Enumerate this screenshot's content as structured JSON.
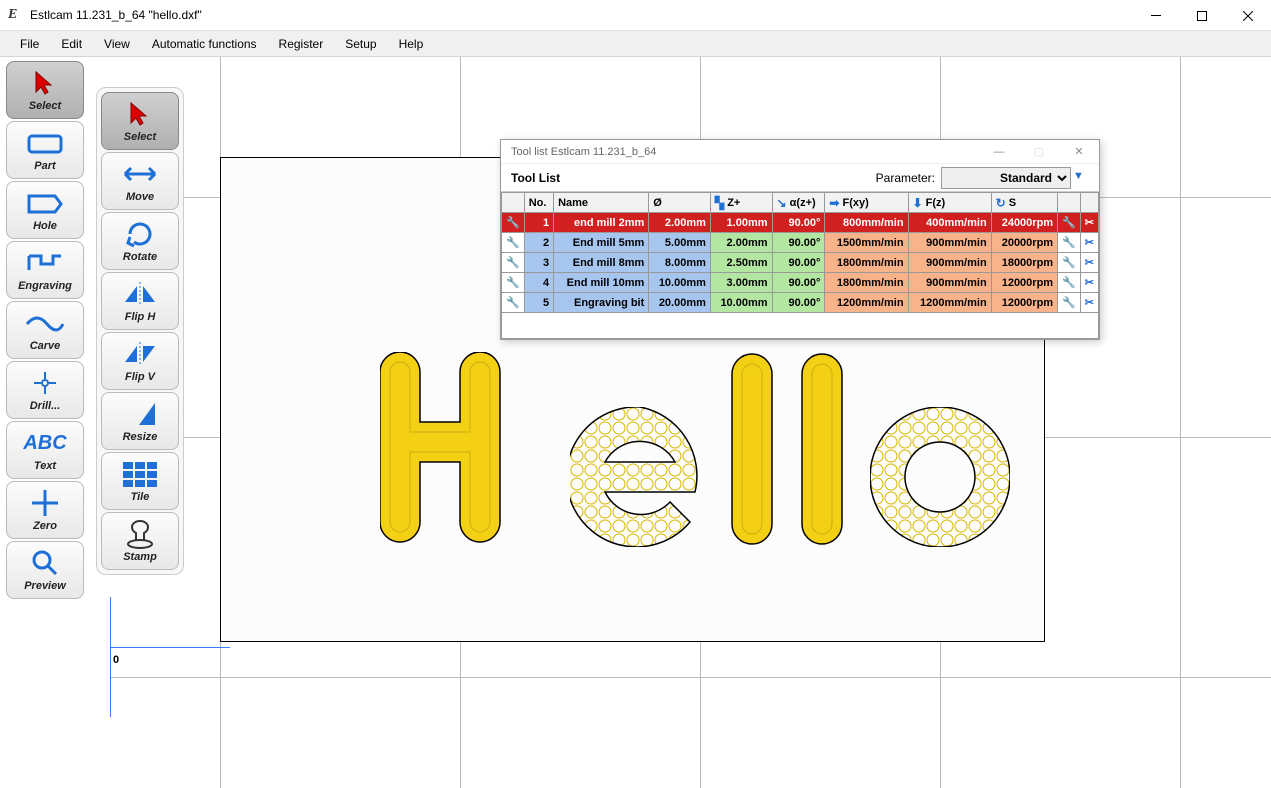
{
  "window": {
    "title": "Estlcam 11.231_b_64 \"hello.dxf\"",
    "app_abbrev": "E"
  },
  "menu": {
    "items": [
      "File",
      "Edit",
      "View",
      "Automatic functions",
      "Register",
      "Setup",
      "Help"
    ]
  },
  "toolbar1": [
    {
      "id": "select",
      "label": "Select",
      "icon": "cursor",
      "active": true
    },
    {
      "id": "part",
      "label": "Part",
      "icon": "part"
    },
    {
      "id": "hole",
      "label": "Hole",
      "icon": "hole"
    },
    {
      "id": "engraving",
      "label": "Engraving",
      "icon": "engraving"
    },
    {
      "id": "carve",
      "label": "Carve",
      "icon": "carve"
    },
    {
      "id": "drill",
      "label": "Drill...",
      "icon": "drill"
    },
    {
      "id": "text",
      "label": "Text",
      "icon": "text"
    },
    {
      "id": "zero",
      "label": "Zero",
      "icon": "zero"
    },
    {
      "id": "preview",
      "label": "Preview",
      "icon": "preview"
    }
  ],
  "toolbar2": [
    {
      "id": "select2",
      "label": "Select",
      "icon": "cursor",
      "active": true
    },
    {
      "id": "move",
      "label": "Move",
      "icon": "move"
    },
    {
      "id": "rotate",
      "label": "Rotate",
      "icon": "rotate"
    },
    {
      "id": "fliph",
      "label": "Flip H",
      "icon": "fliph"
    },
    {
      "id": "flipv",
      "label": "Flip V",
      "icon": "flipv"
    },
    {
      "id": "resize",
      "label": "Resize",
      "icon": "resize"
    },
    {
      "id": "tile",
      "label": "Tile",
      "icon": "tile"
    },
    {
      "id": "stamp",
      "label": "Stamp",
      "icon": "stamp"
    }
  ],
  "canvas": {
    "origin_label": "0"
  },
  "tool_list": {
    "win_title": "Tool list Estlcam 11.231_b_64",
    "header": "Tool List",
    "param_label": "Parameter:",
    "param_value": "Standard",
    "cols": {
      "no": "No.",
      "name": "Name",
      "dia": "Ø",
      "z": "Z+",
      "ang": "α(z+)",
      "fxy": "F(xy)",
      "fz": "F(z)",
      "s": "S"
    },
    "rows": [
      {
        "no": "1",
        "name": "end mill 2mm",
        "dia": "2.00mm",
        "z": "1.00mm",
        "ang": "90.00°",
        "fxy": "800mm/min",
        "fz": "400mm/min",
        "s": "24000rpm",
        "selected": true
      },
      {
        "no": "2",
        "name": "End mill 5mm",
        "dia": "5.00mm",
        "z": "2.00mm",
        "ang": "90.00°",
        "fxy": "1500mm/min",
        "fz": "900mm/min",
        "s": "20000rpm"
      },
      {
        "no": "3",
        "name": "End mill 8mm",
        "dia": "8.00mm",
        "z": "2.50mm",
        "ang": "90.00°",
        "fxy": "1800mm/min",
        "fz": "900mm/min",
        "s": "18000rpm"
      },
      {
        "no": "4",
        "name": "End mill 10mm",
        "dia": "10.00mm",
        "z": "3.00mm",
        "ang": "90.00°",
        "fxy": "1800mm/min",
        "fz": "900mm/min",
        "s": "12000rpm"
      },
      {
        "no": "5",
        "name": "Engraving bit",
        "dia": "20.00mm",
        "z": "10.00mm",
        "ang": "90.00°",
        "fxy": "1200mm/min",
        "fz": "1200mm/min",
        "s": "12000rpm"
      }
    ]
  }
}
